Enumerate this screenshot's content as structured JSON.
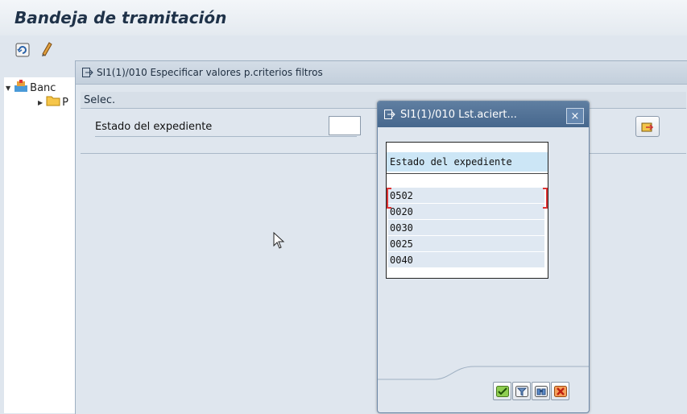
{
  "page": {
    "title": "Bandeja de tramitación"
  },
  "toolbar": {
    "icons": [
      "refresh-icon",
      "edit-icon"
    ]
  },
  "tree": {
    "root_label": "Banc",
    "child_label": "P"
  },
  "filter_dialog": {
    "title": "SI1(1)/010 Especificar valores p.criterios filtros",
    "group_label": "Selec.",
    "field_label": "Estado del expediente",
    "field_value": ""
  },
  "hit_list": {
    "title": "SI1(1)/010  Lst.aciert...",
    "close_label": "×",
    "column_header": "Estado del expediente",
    "rows": [
      "0502",
      "0020",
      "0030",
      "0025",
      "0040"
    ],
    "buttons": [
      "check-icon",
      "filter-icon",
      "find-icon",
      "cancel-icon"
    ]
  },
  "colors": {
    "title_text": "#1f3249",
    "popup_title_bg": "#4f7097",
    "header_bg": "#cce6f6",
    "row_bg": "#dfe8f2"
  }
}
